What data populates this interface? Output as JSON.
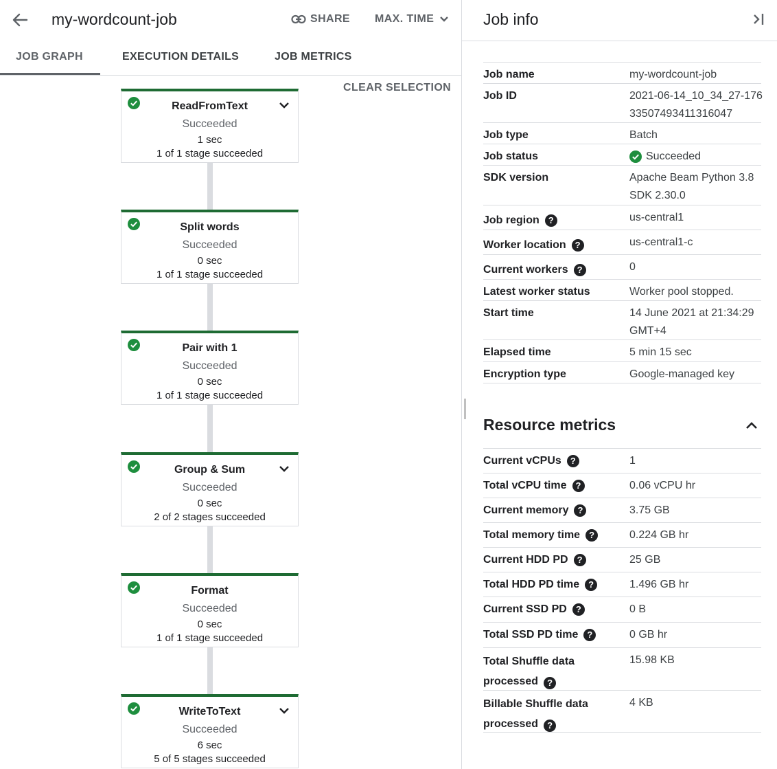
{
  "header": {
    "job_title": "my-wordcount-job",
    "share_label": "SHARE",
    "max_time_label": "MAX. TIME"
  },
  "tabs": [
    {
      "label": "JOB GRAPH",
      "active": true
    },
    {
      "label": "EXECUTION DETAILS",
      "active": false
    },
    {
      "label": "JOB METRICS",
      "active": false
    }
  ],
  "graph": {
    "clear_selection_label": "CLEAR SELECTION",
    "nodes": [
      {
        "name": "ReadFromText",
        "status": "Succeeded",
        "time": "1 sec",
        "stages": "1 of 1 stage succeeded",
        "expandable": true
      },
      {
        "name": "Split words",
        "status": "Succeeded",
        "time": "0 sec",
        "stages": "1 of 1 stage succeeded",
        "expandable": false
      },
      {
        "name": "Pair with 1",
        "status": "Succeeded",
        "time": "0 sec",
        "stages": "1 of 1 stage succeeded",
        "expandable": false
      },
      {
        "name": "Group & Sum",
        "status": "Succeeded",
        "time": "0 sec",
        "stages": "2 of 2 stages succeeded",
        "expandable": true
      },
      {
        "name": "Format",
        "status": "Succeeded",
        "time": "0 sec",
        "stages": "1 of 1 stage succeeded",
        "expandable": false
      },
      {
        "name": "WriteToText",
        "status": "Succeeded",
        "time": "6 sec",
        "stages": "5 of 5 stages succeeded",
        "expandable": true
      }
    ]
  },
  "job_info": {
    "title": "Job info",
    "rows": [
      {
        "key": "Job name",
        "value": "my-wordcount-job",
        "help": false
      },
      {
        "key": "Job ID",
        "value": "2021-06-14_10_34_27-17633507493411316047",
        "help": false
      },
      {
        "key": "Job type",
        "value": "Batch",
        "help": false
      },
      {
        "key": "Job status",
        "value": "Succeeded",
        "help": false
      },
      {
        "key": "SDK version",
        "value": "Apache Beam Python 3.8 SDK 2.30.0",
        "help": false
      },
      {
        "key": "Job region",
        "value": "us-central1",
        "help": true
      },
      {
        "key": "Worker location",
        "value": "us-central1-c",
        "help": true
      },
      {
        "key": "Current workers",
        "value": "0",
        "help": true
      },
      {
        "key": "Latest worker status",
        "value": "Worker pool stopped.",
        "help": false
      },
      {
        "key": "Start time",
        "value": "14 June 2021 at 21:34:29 GMT+4",
        "help": false
      },
      {
        "key": "Elapsed time",
        "value": "5 min 15 sec",
        "help": false
      },
      {
        "key": "Encryption type",
        "value": "Google-managed key",
        "help": false
      }
    ]
  },
  "resource_metrics": {
    "title": "Resource metrics",
    "rows": [
      {
        "key": "Current vCPUs",
        "value": "1",
        "help": true
      },
      {
        "key": "Total vCPU time",
        "value": "0.06 vCPU hr",
        "help": true
      },
      {
        "key": "Current memory",
        "value": "3.75 GB",
        "help": true
      },
      {
        "key": "Total memory time",
        "value": "0.224 GB hr",
        "help": true
      },
      {
        "key": "Current HDD PD",
        "value": "25 GB",
        "help": true
      },
      {
        "key": "Total HDD PD time",
        "value": "1.496 GB hr",
        "help": true
      },
      {
        "key": "Current SSD PD",
        "value": "0 B",
        "help": true
      },
      {
        "key": "Total SSD PD time",
        "value": "0 GB hr",
        "help": true
      },
      {
        "key": "Total Shuffle data processed",
        "value": "15.98 KB",
        "help": true
      },
      {
        "key": "Billable Shuffle data processed",
        "value": "4 KB",
        "help": true
      }
    ]
  },
  "colors": {
    "success_green": "#1e8e3e",
    "node_top_border": "#1e6b33",
    "muted_text": "#5f6368",
    "border": "#dadce0"
  },
  "icons": {
    "back": "arrow-left-icon",
    "share": "link-icon",
    "dropdown": "chevron-down-icon",
    "collapse_panel": "collapse-panel-icon",
    "status": "check-circle-icon",
    "help": "help-circle-icon",
    "section_toggle": "chevron-up-icon"
  }
}
